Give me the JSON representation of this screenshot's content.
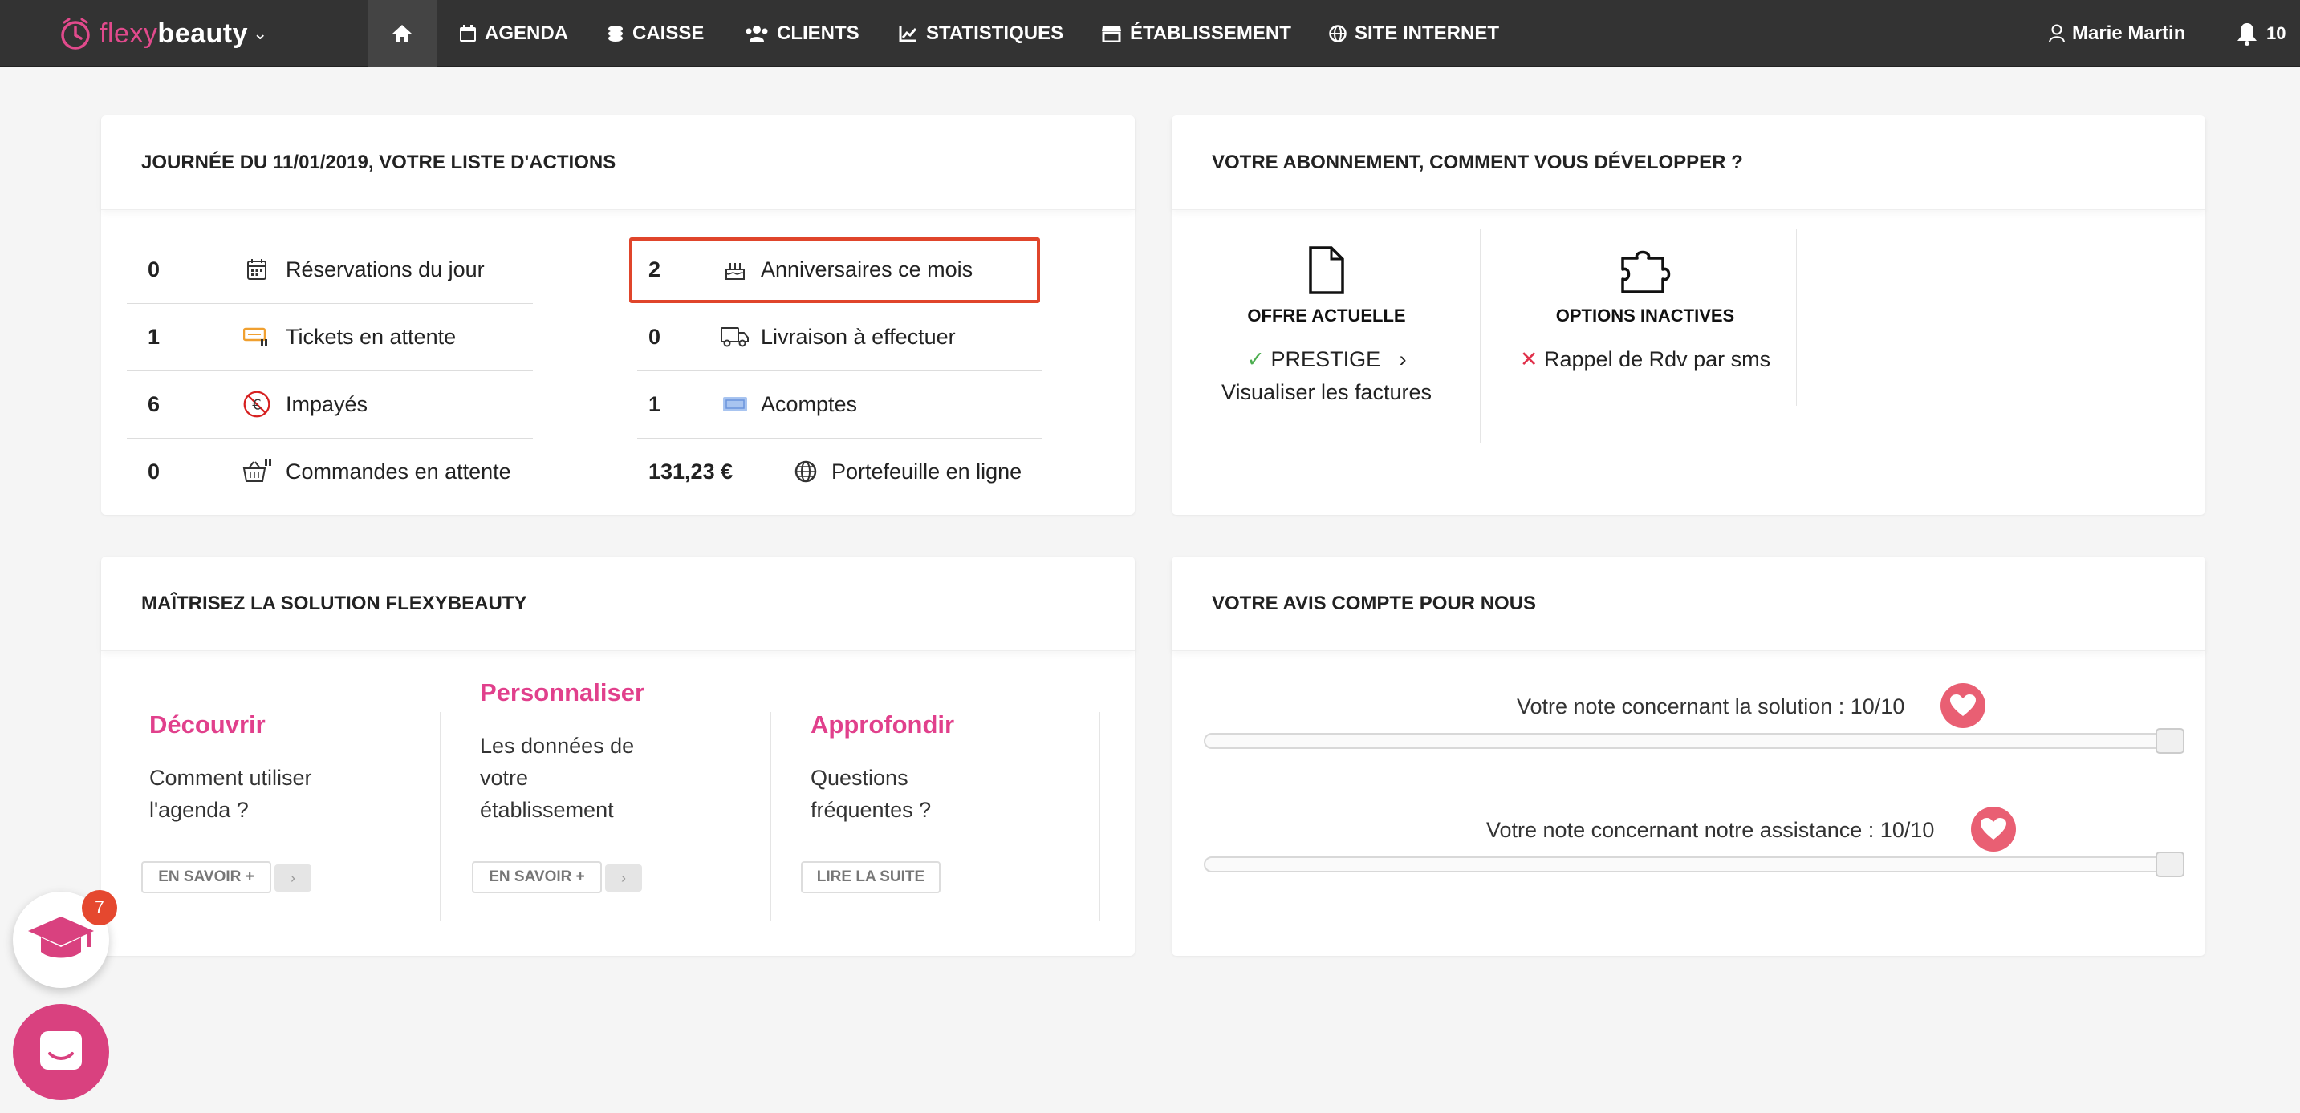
{
  "nav": {
    "brand_part1": "flexy",
    "brand_part2": "beauty",
    "items": [
      "AGENDA",
      "CAISSE",
      "CLIENTS",
      "STATISTIQUES",
      "ÉTABLISSEMENT",
      "SITE INTERNET"
    ],
    "user_name": "Marie Martin",
    "notifications": "10"
  },
  "actions": {
    "title": "JOURNÉE DU 11/01/2019, VOTRE LISTE D'ACTIONS",
    "left": [
      {
        "count": "0",
        "label": "Réservations du jour",
        "icon": "calendar-icon"
      },
      {
        "count": "1",
        "label": "Tickets en attente",
        "icon": "ticket-icon"
      },
      {
        "count": "6",
        "label": "Impayés",
        "icon": "no-euro-icon"
      },
      {
        "count": "0",
        "label": "Commandes en attente",
        "icon": "basket-icon"
      }
    ],
    "right": [
      {
        "count": "2",
        "label": "Anniversaires ce mois",
        "icon": "cake-icon"
      },
      {
        "count": "0",
        "label": "Livraison à effectuer",
        "icon": "truck-icon"
      },
      {
        "count": "1",
        "label": "Acomptes",
        "icon": "deposit-icon"
      },
      {
        "count": "131,23 €",
        "label": "Portefeuille en ligne",
        "icon": "globe-icon"
      }
    ],
    "highlight_color": "#e0452b"
  },
  "subscription": {
    "title": "VOTRE ABONNEMENT, COMMENT VOUS DÉVELOPPER ?",
    "current_title": "OFFRE ACTUELLE",
    "current_plan": "PRESTIGE",
    "invoices_link": "Visualiser les factures",
    "inactive_title": "OPTIONS INACTIVES",
    "inactive_options": [
      "Rappel de Rdv par sms"
    ]
  },
  "learn": {
    "title": "MAÎTRISEZ LA SOLUTION FLEXYBEAUTY",
    "columns": [
      {
        "title": "Découvrir",
        "text": [
          "Comment utiliser",
          "l'agenda ?"
        ],
        "button": "EN SAVOIR +"
      },
      {
        "title": "Personnaliser",
        "text": [
          "Les données de",
          "votre",
          "établissement"
        ],
        "button": "EN SAVOIR +"
      },
      {
        "title": "Approfondir",
        "text": [
          "Questions",
          "fréquentes ?"
        ],
        "button": "LIRE LA SUITE"
      }
    ],
    "accent": "#e1408c"
  },
  "feedback": {
    "title": "VOTRE AVIS COMPTE POUR NOUS",
    "ratings": [
      {
        "label": "Votre note concernant la solution : 10/10",
        "value": 10,
        "max": 10
      },
      {
        "label": "Votre note concernant notre assistance : 10/10",
        "value": 10,
        "max": 10
      }
    ]
  },
  "floating": {
    "academy_badge": "7"
  }
}
